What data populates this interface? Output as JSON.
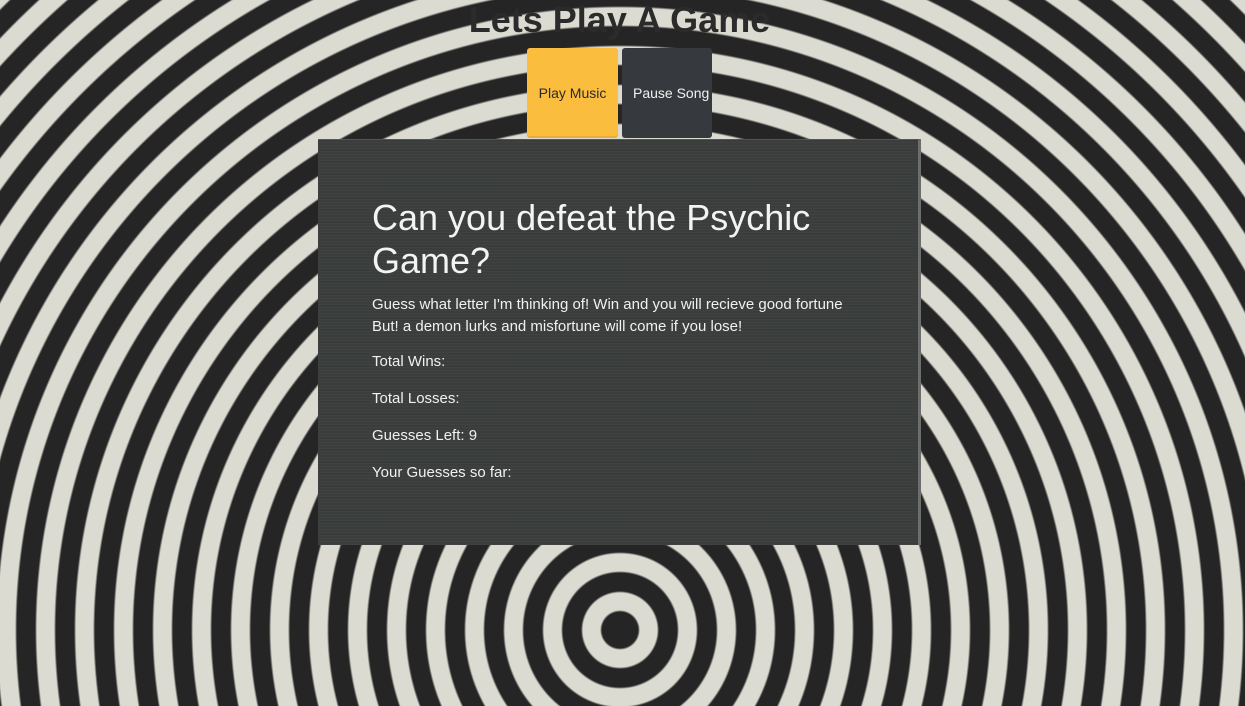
{
  "header": {
    "title": "Lets Play A Game"
  },
  "controls": {
    "play_label": "Play Music",
    "pause_label": "Pause Song"
  },
  "game": {
    "heading": "Can you defeat the Psychic Game?",
    "intro_line1": "Guess what letter I'm thinking of! Win and you will recieve good fortune",
    "intro_line2": "But! a demon lurks and misfortune will come if you lose!",
    "wins_label": "Total Wins:",
    "wins_value": "",
    "losses_label": "Total Losses:",
    "losses_value": "",
    "guesses_left_label": "Guesses Left:",
    "guesses_left_value": "9",
    "guesses_so_far_label": "Your Guesses so far:",
    "guesses_so_far_value": ""
  },
  "colors": {
    "play_button": "#fbbd3d",
    "pause_button": "#363a3f",
    "panel_background": "#3a3d3b"
  }
}
